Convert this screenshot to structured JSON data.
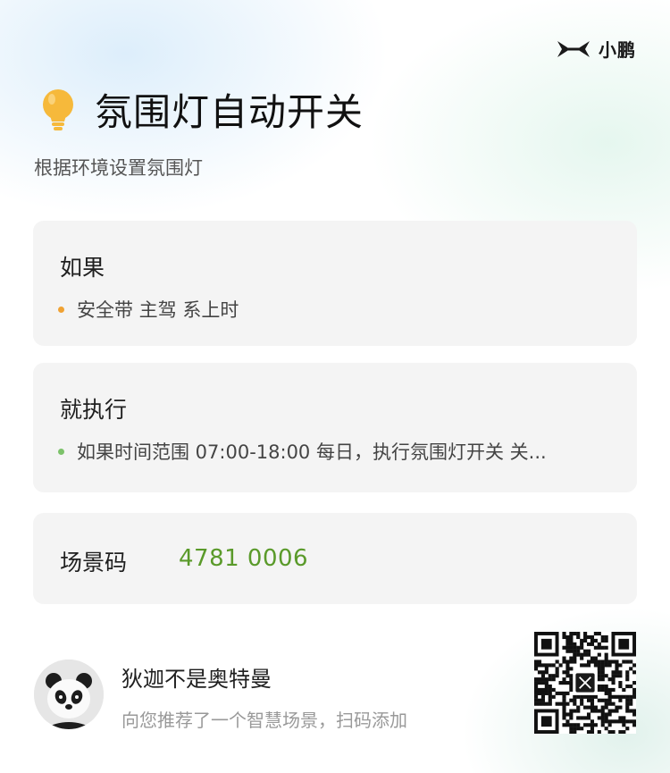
{
  "brand": {
    "name": "小鹏",
    "logo_icon": "xpeng-x-logo-icon"
  },
  "header": {
    "icon": "lightbulb-icon",
    "title": "氛围灯自动开关",
    "subtitle": "根据环境设置氛围灯"
  },
  "condition": {
    "title": "如果",
    "items": [
      "安全带 主驾 系上时"
    ]
  },
  "action": {
    "title": "就执行",
    "items": [
      "如果时间范围 07:00-18:00 每日，执行氛围灯开关 关..."
    ]
  },
  "scene_code": {
    "label": "场景码",
    "value": "4781 0006"
  },
  "share": {
    "user_name": "狄迦不是奥特曼",
    "description": "向您推荐了一个智慧场景，扫码添加",
    "avatar": "panda-avatar-icon",
    "qr": "qr-code-icon"
  },
  "colors": {
    "accent_green": "#5a9a2a",
    "bullet_orange": "#f0a233",
    "bullet_green": "#7cc26a",
    "bulb_yellow": "#f6b93b"
  }
}
